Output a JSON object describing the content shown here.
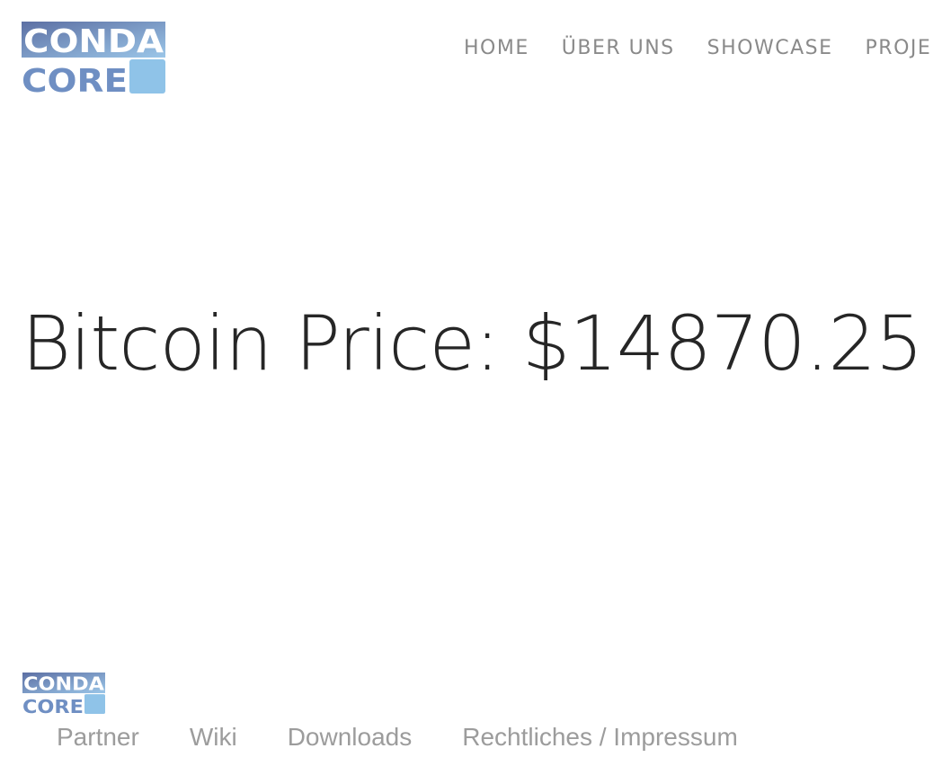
{
  "header": {
    "logo": {
      "line1": "CONDA",
      "line2": "CORE"
    },
    "nav": [
      {
        "label": "HOME"
      },
      {
        "label": "ÜBER UNS"
      },
      {
        "label": "SHOWCASE"
      },
      {
        "label": "PROJE"
      }
    ]
  },
  "main": {
    "headline_label": "Bitcoin Price:",
    "price": "$14870.25"
  },
  "footer": {
    "logo": {
      "line1": "CONDA",
      "line2": "CORE"
    },
    "links": [
      {
        "label": "Partner"
      },
      {
        "label": "Wiki"
      },
      {
        "label": "Downloads"
      },
      {
        "label": "Rechtliches / Impressum"
      }
    ]
  },
  "colors": {
    "logo_dark": "#5c6fa3",
    "logo_light": "#8fc3e8",
    "nav_text": "#8a8a8a",
    "headline_text": "#262626",
    "footer_text": "#9c9c9c"
  }
}
